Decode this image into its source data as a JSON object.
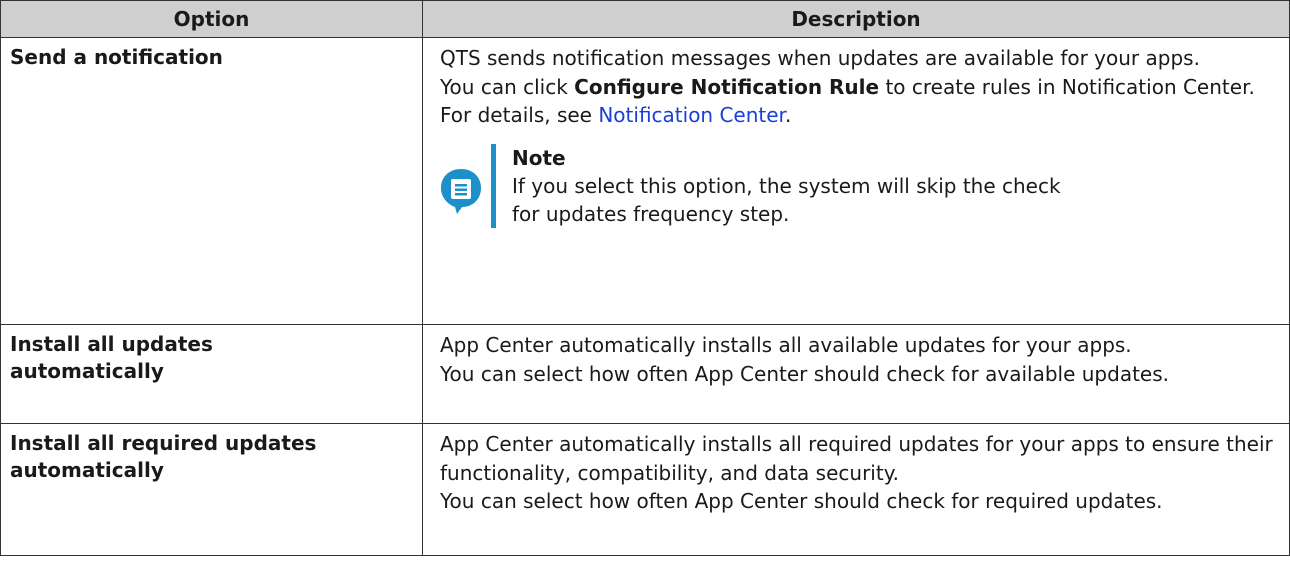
{
  "table": {
    "headers": [
      "Option",
      "Description"
    ],
    "rows": [
      {
        "option": "Send a notification",
        "desc_line1": "QTS sends notification messages when updates are available for your apps.",
        "desc_line2_pre": "You can click ",
        "desc_line2_bold": "Configure Notification Rule",
        "desc_line2_mid": " to create rules in Notification Center. For details, see ",
        "desc_link": "Notification Center",
        "desc_line2_post": ".",
        "note_icon": "note-icon",
        "note_title": "Note",
        "note_text": "If you select this option, the system will skip the check for updates frequency step."
      },
      {
        "option": "Install all updates automatically",
        "desc_line1": "App Center automatically installs all available updates for your apps.",
        "desc_line2": "You can select how often App Center should check for available updates."
      },
      {
        "option": "Install all required updates automatically",
        "desc_line1": "App Center automatically installs all required updates for your apps to ensure their functionality, compatibility, and data security.",
        "desc_line2": "You can select how often App Center should check for required updates."
      }
    ]
  },
  "colors": {
    "header_bg": "#cfcfcf",
    "link": "#1a3fd6",
    "note_accent": "#1d8fc9"
  }
}
